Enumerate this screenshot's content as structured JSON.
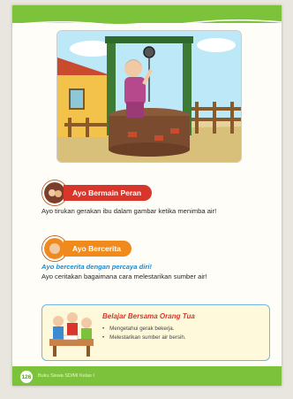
{
  "section1": {
    "label": "Ayo Bermain Peran",
    "text": "Ayo tirukan gerakan ibu dalam gambar ketika menimba air!"
  },
  "section2": {
    "label": "Ayo Bercerita",
    "subtitle": "Ayo bercerita dengan percaya diri!",
    "text": "Ayo ceritakan bagaimana cara melestarikan sumber air!"
  },
  "parent_box": {
    "title": "Belajar Bersama Orang Tua",
    "items": [
      "Mengetahui gerak bekerja.",
      "Melestarikan sumber air bersih."
    ]
  },
  "footer": {
    "page_number": "126",
    "label": "Buku Siswa SD/MI Kelas I"
  },
  "colors": {
    "green": "#7cc23a",
    "red": "#d9362b",
    "orange": "#f08a1c",
    "blue": "#1b8ad0"
  }
}
